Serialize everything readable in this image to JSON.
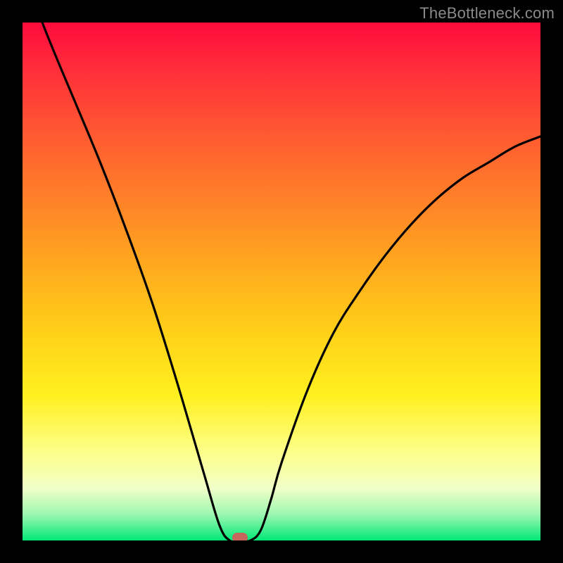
{
  "watermark": "TheBottleneck.com",
  "colors": {
    "frame": "#000000",
    "curve": "#000000",
    "marker": "#c4665b",
    "gradient_top": "#ff0a3c",
    "gradient_bottom": "#00e878"
  },
  "chart_data": {
    "type": "line",
    "title": "",
    "xlabel": "",
    "ylabel": "",
    "xlim": [
      0,
      100
    ],
    "ylim": [
      0,
      100
    ],
    "grid": false,
    "legend": false,
    "series": [
      {
        "name": "bottleneck-curve",
        "x": [
          0,
          5,
          10,
          15,
          20,
          25,
          30,
          35,
          38,
          40,
          42,
          44,
          46,
          48,
          50,
          55,
          60,
          65,
          70,
          75,
          80,
          85,
          90,
          95,
          100
        ],
        "y": [
          110,
          97,
          85,
          73,
          60,
          46,
          30,
          13,
          3,
          0,
          0,
          0,
          2,
          8,
          15,
          29,
          40,
          48,
          55,
          61,
          66,
          70,
          73,
          76,
          78
        ]
      }
    ],
    "marker": {
      "x": 42,
      "y": 0
    },
    "gradient_stops": [
      {
        "pos": 0,
        "color": "#ff0a3c"
      },
      {
        "pos": 8,
        "color": "#ff2a3a"
      },
      {
        "pos": 20,
        "color": "#ff5432"
      },
      {
        "pos": 32,
        "color": "#ff7a2a"
      },
      {
        "pos": 45,
        "color": "#ffa31f"
      },
      {
        "pos": 60,
        "color": "#ffd118"
      },
      {
        "pos": 72,
        "color": "#fff020"
      },
      {
        "pos": 83,
        "color": "#fdff8a"
      },
      {
        "pos": 90,
        "color": "#f0ffc8"
      },
      {
        "pos": 95,
        "color": "#9cf7b0"
      },
      {
        "pos": 100,
        "color": "#00e878"
      }
    ]
  }
}
